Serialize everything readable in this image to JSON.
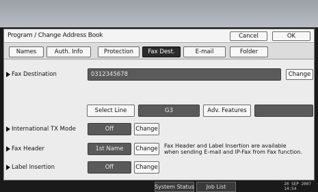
{
  "title": "Program / Change Address Book",
  "header_buttons": {
    "cancel": "Cancel",
    "ok": "OK"
  },
  "tabs": [
    {
      "label": "Names",
      "active": false
    },
    {
      "label": "Auth. Info",
      "active": false
    },
    {
      "label": "Protection",
      "active": false
    },
    {
      "label": "Fax Dest.",
      "active": true
    },
    {
      "label": "E-mail",
      "active": false
    },
    {
      "label": "Folder",
      "active": false
    }
  ],
  "fax_destination": {
    "label": "Fax Destination",
    "value": "0312345678",
    "change": "Change"
  },
  "line": {
    "select_line": "Select Line",
    "value": "G3",
    "adv_features": "Adv. Features",
    "adv_value": ""
  },
  "international_tx": {
    "label": "International TX Mode",
    "value": "Off",
    "change": "Change"
  },
  "fax_header": {
    "label": "Fax Header",
    "value": "1st Name",
    "change": "Change"
  },
  "label_insertion": {
    "label": "Label Insertion",
    "value": "Off",
    "change": "Change"
  },
  "info_text": {
    "line1": "Fax Header and Label Insertion are available",
    "line2": "when sending E-mail and IP-Fax from Fax function."
  },
  "status_bar": {
    "system_status": "System Status",
    "job_list": "Job List",
    "date": "20 SEP  2007",
    "time": "14:54"
  },
  "colors": {
    "active_tab": "#2b2b2b",
    "dark_field": "#5a5a5a",
    "panel": "#ececec"
  }
}
